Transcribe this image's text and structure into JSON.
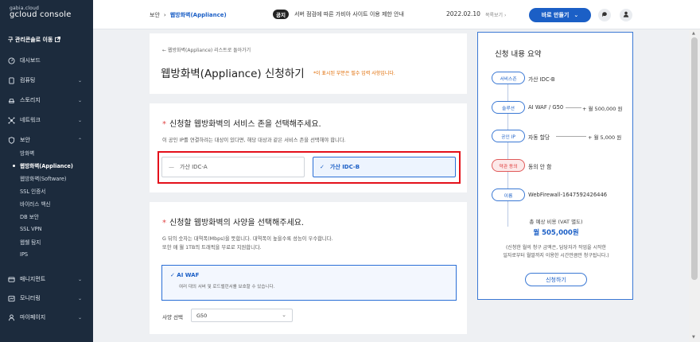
{
  "brand": {
    "top": "gabia.cloud",
    "bottom": "gcloud console"
  },
  "sidebar": {
    "old_console": "구 관리콘솔로 이동",
    "items": [
      {
        "label": "대시보드",
        "icon": "dashboard-icon",
        "has_chevron": false
      },
      {
        "label": "컴퓨팅",
        "icon": "server-icon",
        "has_chevron": true
      },
      {
        "label": "스토리지",
        "icon": "storage-icon",
        "has_chevron": true
      },
      {
        "label": "네트워크",
        "icon": "network-icon",
        "has_chevron": true
      },
      {
        "label": "보안",
        "icon": "shield-icon",
        "has_chevron": true,
        "expanded": true
      },
      {
        "label": "매니지먼트",
        "icon": "management-icon",
        "has_chevron": true
      },
      {
        "label": "모니터링",
        "icon": "monitor-icon",
        "has_chevron": true
      },
      {
        "label": "마이페이지",
        "icon": "user-icon",
        "has_chevron": true
      }
    ],
    "security_sub": [
      {
        "label": "방화벽",
        "active": false
      },
      {
        "label": "웹방화벽(Appliance)",
        "active": true
      },
      {
        "label": "웹방화벽(Software)",
        "active": false
      },
      {
        "label": "SSL 인증서",
        "active": false
      },
      {
        "label": "바이러스 백신",
        "active": false
      },
      {
        "label": "DB 보안",
        "active": false
      },
      {
        "label": "SSL VPN",
        "active": false
      },
      {
        "label": "웹쉘 탐지",
        "active": false
      },
      {
        "label": "IPS",
        "active": false
      }
    ]
  },
  "topbar": {
    "breadcrumb_parent": "보안",
    "breadcrumb_sep": "›",
    "breadcrumb_current": "웹방화벽(Appliance)",
    "notice_tag": "공지",
    "notice_text": "서버 점검에 따른 가비아 사이트 이용 제한 안내",
    "notice_date": "2022.02.10",
    "notice_more": "목록보기 ›",
    "create_label": "바로 만들기"
  },
  "main": {
    "back_link": "← 웹방화벽(Appliance) 리스트로 돌아가기",
    "title": "웹방화벽(Appliance) 신청하기",
    "required_note": "*이 표시된 부분은 필수 입력 사항입니다.",
    "zone_section": {
      "asterisk": "*",
      "title": "신청할 웹방화벽의 서비스 존을 선택해주세요.",
      "desc": "이 공인 IP를 연결하려는 대상이 있다면, 해당 대상과 같은 서비스 존을 선택해야 합니다.",
      "options": [
        {
          "label": "가산 IDC-A",
          "mark": "—",
          "selected": false
        },
        {
          "label": "가산 IDC-B",
          "mark": "✓",
          "selected": true
        }
      ]
    },
    "spec_section": {
      "asterisk": "*",
      "title": "신청할 웹방화벽의 사양을 선택해주세요.",
      "desc_line1": "G 뒤의 숫자는 대역폭(Mbps)을 뜻합니다. 대역폭이 높을수록 성능이 우수합니다.",
      "desc_line2": "또한 매 월 1TB의 트래픽을 무료로 지원합니다.",
      "card_title": "✓  AI WAF",
      "card_desc": "여러 대의 서버 및 로드밸런서를 보호할 수 있습니다.",
      "select_label": "사양 선택",
      "select_value": "G50"
    }
  },
  "summary": {
    "title": "신청 내용 요약",
    "rows": [
      {
        "pill": "서비스존",
        "value": "가산 IDC-B",
        "price": "",
        "warn": false
      },
      {
        "pill": "솔루션",
        "value": "AI WAF / G50",
        "price": "+ 월 500,000 원",
        "warn": false
      },
      {
        "pill": "공인 IP",
        "value": "자동 할당",
        "price": "+ 월 5,000 원",
        "warn": false
      },
      {
        "pill": "약관 동의",
        "value": "동의 안 함",
        "price": "",
        "warn": true
      },
      {
        "pill": "이름",
        "value": "WebFirewall-1647592426446",
        "price": "",
        "warn": false
      }
    ],
    "total_label": "총 예상 비용 (VAT 별도)",
    "total_price": "월 505,000원",
    "note_line1": "(신청한 월의 청구 금액은, 담당자가 작업을 시작한",
    "note_line2": "일자로부터 월말까지 이용한 시간만큼만 청구됩니다.)",
    "apply_label": "신청하기"
  },
  "colors": {
    "accent": "#1b5fc6",
    "sidebar_bg": "#1c2b3d",
    "highlight": "#e4101a",
    "warn": "#e05a5a"
  }
}
